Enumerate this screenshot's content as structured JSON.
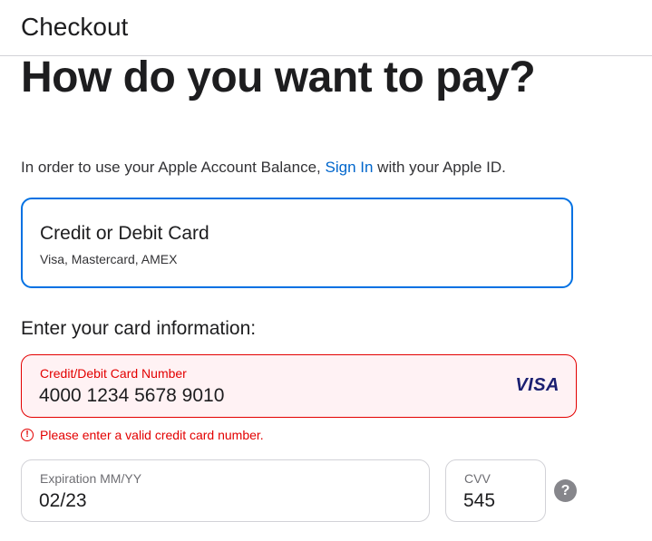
{
  "header": {
    "title": "Checkout"
  },
  "main": {
    "heading": "How do you want to pay?",
    "balance_note": {
      "prefix": "In order to use your Apple Account Balance, ",
      "link": "Sign In",
      "suffix": " with your Apple ID."
    },
    "payment_option": {
      "title": "Credit or Debit Card",
      "subtitle": "Visa, Mastercard, AMEX"
    },
    "card_info_label": "Enter your card information:",
    "card_number": {
      "label": "Credit/Debit Card Number",
      "value": "4000 1234 5678 9010",
      "brand": "VISA",
      "error": "Please enter a valid credit card number.",
      "error_icon_glyph": "!"
    },
    "expiration": {
      "label": "Expiration MM/YY",
      "value": "02/23"
    },
    "cvv": {
      "label": "CVV",
      "value": "545",
      "help_glyph": "?"
    }
  },
  "colors": {
    "accent": "#0071e3",
    "link": "#0066cc",
    "error": "#e30000",
    "error_bg": "#fff2f4",
    "visa": "#1a1f71"
  }
}
